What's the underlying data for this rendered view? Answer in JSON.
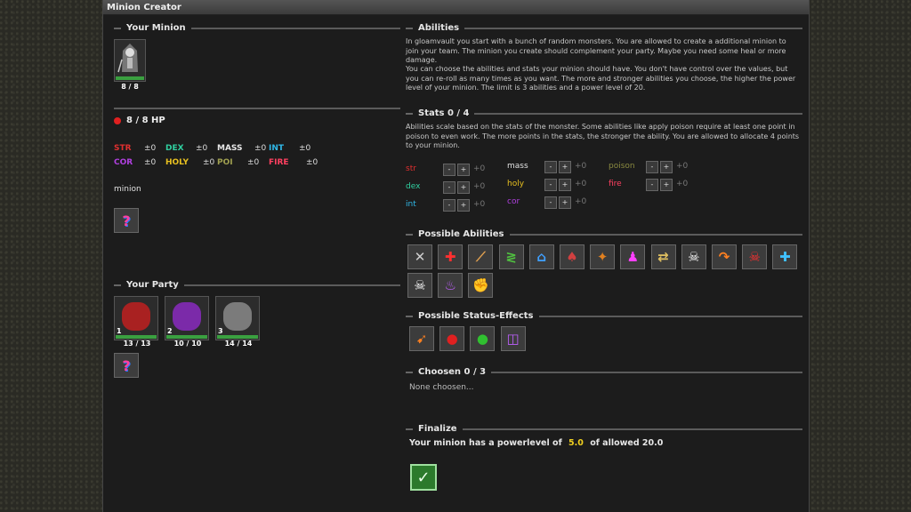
{
  "window": {
    "title": "Minion Creator"
  },
  "your_minion": {
    "heading": "Your Minion",
    "portrait_icon": "hooded-skeleton-icon",
    "hp_text": "8 / 8",
    "hp_fraction": 1.0,
    "hp_line": "8 / 8 HP",
    "stats": [
      {
        "label": "STR",
        "value": "±0",
        "color": "#e03030"
      },
      {
        "label": "DEX",
        "value": "±0",
        "color": "#30d0a0"
      },
      {
        "label": "MASS",
        "value": "±0",
        "color": "#e8e8e8"
      },
      {
        "label": "INT",
        "value": "±0",
        "color": "#30b8e8"
      },
      {
        "label": "COR",
        "value": "±0",
        "color": "#b040e0"
      },
      {
        "label": "HOLY",
        "value": "±0",
        "color": "#e8c020"
      },
      {
        "label": "POI",
        "value": "±0",
        "color": "#a0a050"
      },
      {
        "label": "FIRE",
        "value": "±0",
        "color": "#ff4060"
      }
    ],
    "name": "minion",
    "random_button": "?"
  },
  "party": {
    "heading": "Your Party",
    "members": [
      {
        "index": "1",
        "hp": "13 / 13",
        "icon": "red-ogre-icon"
      },
      {
        "index": "2",
        "hp": "10 / 10",
        "icon": "purple-tentacle-icon"
      },
      {
        "index": "3",
        "hp": "14 / 14",
        "icon": "grey-lizard-icon"
      }
    ],
    "random_button": "?"
  },
  "abilities": {
    "heading": "Abilities",
    "para1": "In gloamvault you start with a bunch of random monsters. You are allowed to create a additional minion to join your team. The minion you create should complement your party. Maybe you need some heal or more damage.",
    "para2": "You can choose the abilities and stats your minion should have. You don't have control over the values, but you can re-roll as many times as you want. The more and stronger abilities you choose, the higher the power level of your minion. The limit is 3 abilities and a power level of 20."
  },
  "stats_section": {
    "heading": "Stats 0 / 4",
    "para": "Abilities scale based on the stats of the monster. Some abilities like apply poison require at least one point in poison to even work. The more points in the stats, the stronger the ability. You are allowed to allocate 4 points to your minion.",
    "minus": "-",
    "plus": "+",
    "rows": [
      {
        "label": "str",
        "value": "+0",
        "color": "#e03030"
      },
      {
        "label": "mass",
        "value": "+0",
        "color": "#e0e0e0"
      },
      {
        "label": "poison",
        "value": "+0",
        "color": "#8a8a40"
      },
      {
        "label": "dex",
        "value": "+0",
        "color": "#30d0a0"
      },
      {
        "label": "holy",
        "value": "+0",
        "color": "#e8c020"
      },
      {
        "label": "fire",
        "value": "+0",
        "color": "#ff4060"
      },
      {
        "label": "int",
        "value": "+0",
        "color": "#30b8e8"
      },
      {
        "label": "cor",
        "value": "+0",
        "color": "#b040e0"
      }
    ]
  },
  "possible_abilities": {
    "heading": "Possible Abilities",
    "icons": [
      {
        "name": "crossed-swords-icon",
        "glyph": "✕",
        "color": "#cfcfcf"
      },
      {
        "name": "red-cross-heal-icon",
        "glyph": "✚",
        "color": "#ff3030"
      },
      {
        "name": "sword-slash-icon",
        "glyph": "⟋",
        "color": "#e0a050"
      },
      {
        "name": "green-claw-icon",
        "glyph": "≷",
        "color": "#50c040"
      },
      {
        "name": "blue-house-icon",
        "glyph": "⌂",
        "color": "#40a0ff"
      },
      {
        "name": "bleeding-figure-icon",
        "glyph": "♠",
        "color": "#d04040"
      },
      {
        "name": "orange-star-icon",
        "glyph": "✦",
        "color": "#e08020"
      },
      {
        "name": "magenta-summon-icon",
        "glyph": "♟",
        "color": "#ff40ff"
      },
      {
        "name": "swap-arrows-icon",
        "glyph": "⇄",
        "color": "#e0c060"
      },
      {
        "name": "white-skull-icon",
        "glyph": "☠",
        "color": "#ffffff"
      },
      {
        "name": "orange-arc-icon",
        "glyph": "↷",
        "color": "#ff8020"
      },
      {
        "name": "red-skull-icon",
        "glyph": "☠",
        "color": "#ff3030"
      },
      {
        "name": "blue-cross-icon",
        "glyph": "✚",
        "color": "#40c0ff"
      },
      {
        "name": "skull-shield-icon",
        "glyph": "☠",
        "color": "#ffffff"
      },
      {
        "name": "purple-flame-icon",
        "glyph": "♨",
        "color": "#c060ff"
      },
      {
        "name": "flexed-arm-icon",
        "glyph": "✊",
        "color": "#f0b060"
      }
    ]
  },
  "status_effects": {
    "heading": "Possible Status-Effects",
    "icons": [
      {
        "name": "fire-bolt-icon",
        "glyph": "➹",
        "color": "#ff8020"
      },
      {
        "name": "blood-drop-icon",
        "glyph": "●",
        "color": "#e02020"
      },
      {
        "name": "poison-drop-icon",
        "glyph": "●",
        "color": "#30c030"
      },
      {
        "name": "purple-spiral-icon",
        "glyph": "◫",
        "color": "#c060ff"
      }
    ]
  },
  "choosen": {
    "heading": "Choosen 0 / 3",
    "empty_text": "None choosen..."
  },
  "finalize": {
    "heading": "Finalize",
    "text_before": "Your minion has a powerlevel of",
    "power": "5.0",
    "text_after": "of allowed 20.0",
    "confirm_glyph": "✓"
  }
}
